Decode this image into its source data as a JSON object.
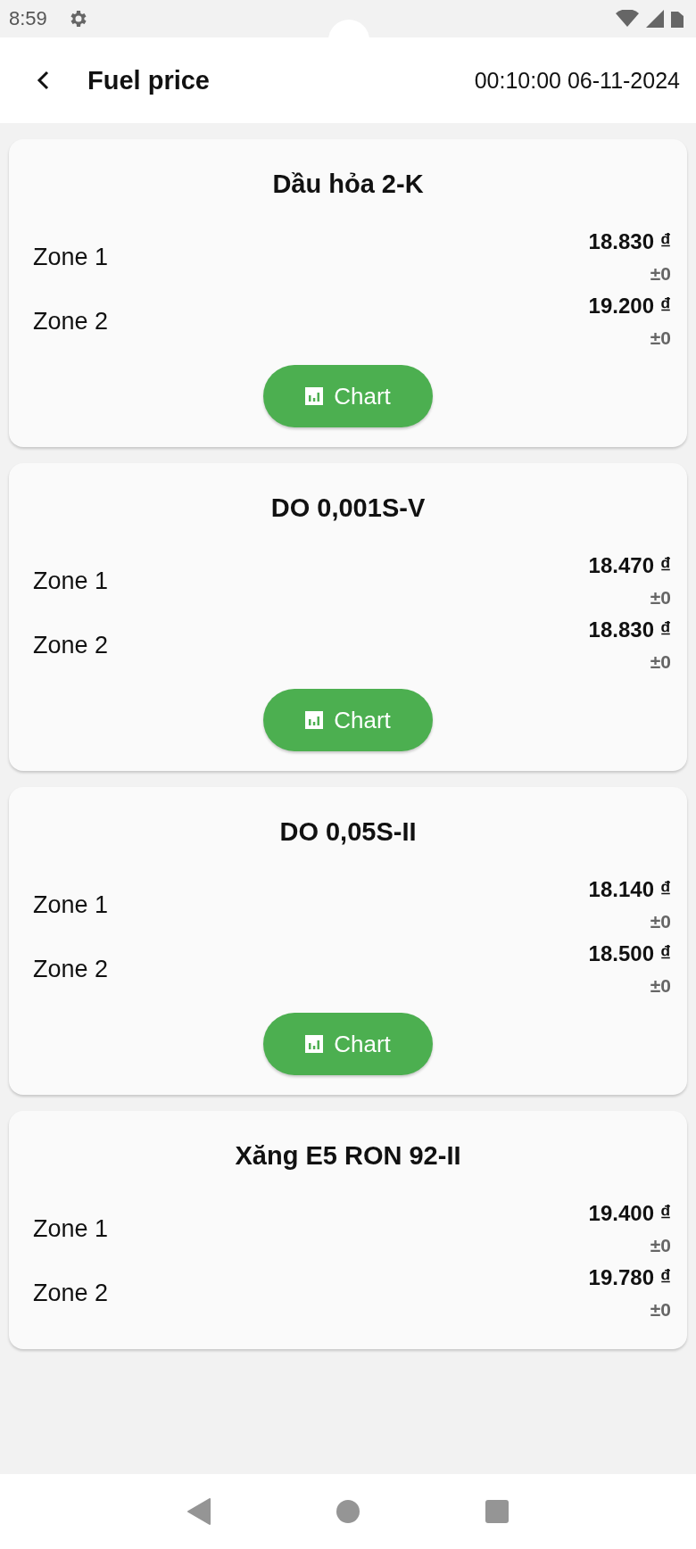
{
  "status_bar": {
    "time": "8:59"
  },
  "app_bar": {
    "title": "Fuel price",
    "timestamp": "00:10:00 06-11-2024"
  },
  "cards": [
    {
      "title": "Dầu hỏa 2-K",
      "zones": [
        {
          "label": "Zone 1",
          "price": "18.830 ₫",
          "change": "±0"
        },
        {
          "label": "Zone 2",
          "price": "19.200 ₫",
          "change": "±0"
        }
      ],
      "button": "Chart"
    },
    {
      "title": "DO 0,001S-V",
      "zones": [
        {
          "label": "Zone 1",
          "price": "18.470 ₫",
          "change": "±0"
        },
        {
          "label": "Zone 2",
          "price": "18.830 ₫",
          "change": "±0"
        }
      ],
      "button": "Chart"
    },
    {
      "title": "DO 0,05S-II",
      "zones": [
        {
          "label": "Zone 1",
          "price": "18.140 ₫",
          "change": "±0"
        },
        {
          "label": "Zone 2",
          "price": "18.500 ₫",
          "change": "±0"
        }
      ],
      "button": "Chart"
    },
    {
      "title": "Xăng E5 RON 92-II",
      "zones": [
        {
          "label": "Zone 1",
          "price": "19.400 ₫",
          "change": "±0"
        },
        {
          "label": "Zone 2",
          "price": "19.780 ₫",
          "change": "±0"
        }
      ]
    }
  ]
}
